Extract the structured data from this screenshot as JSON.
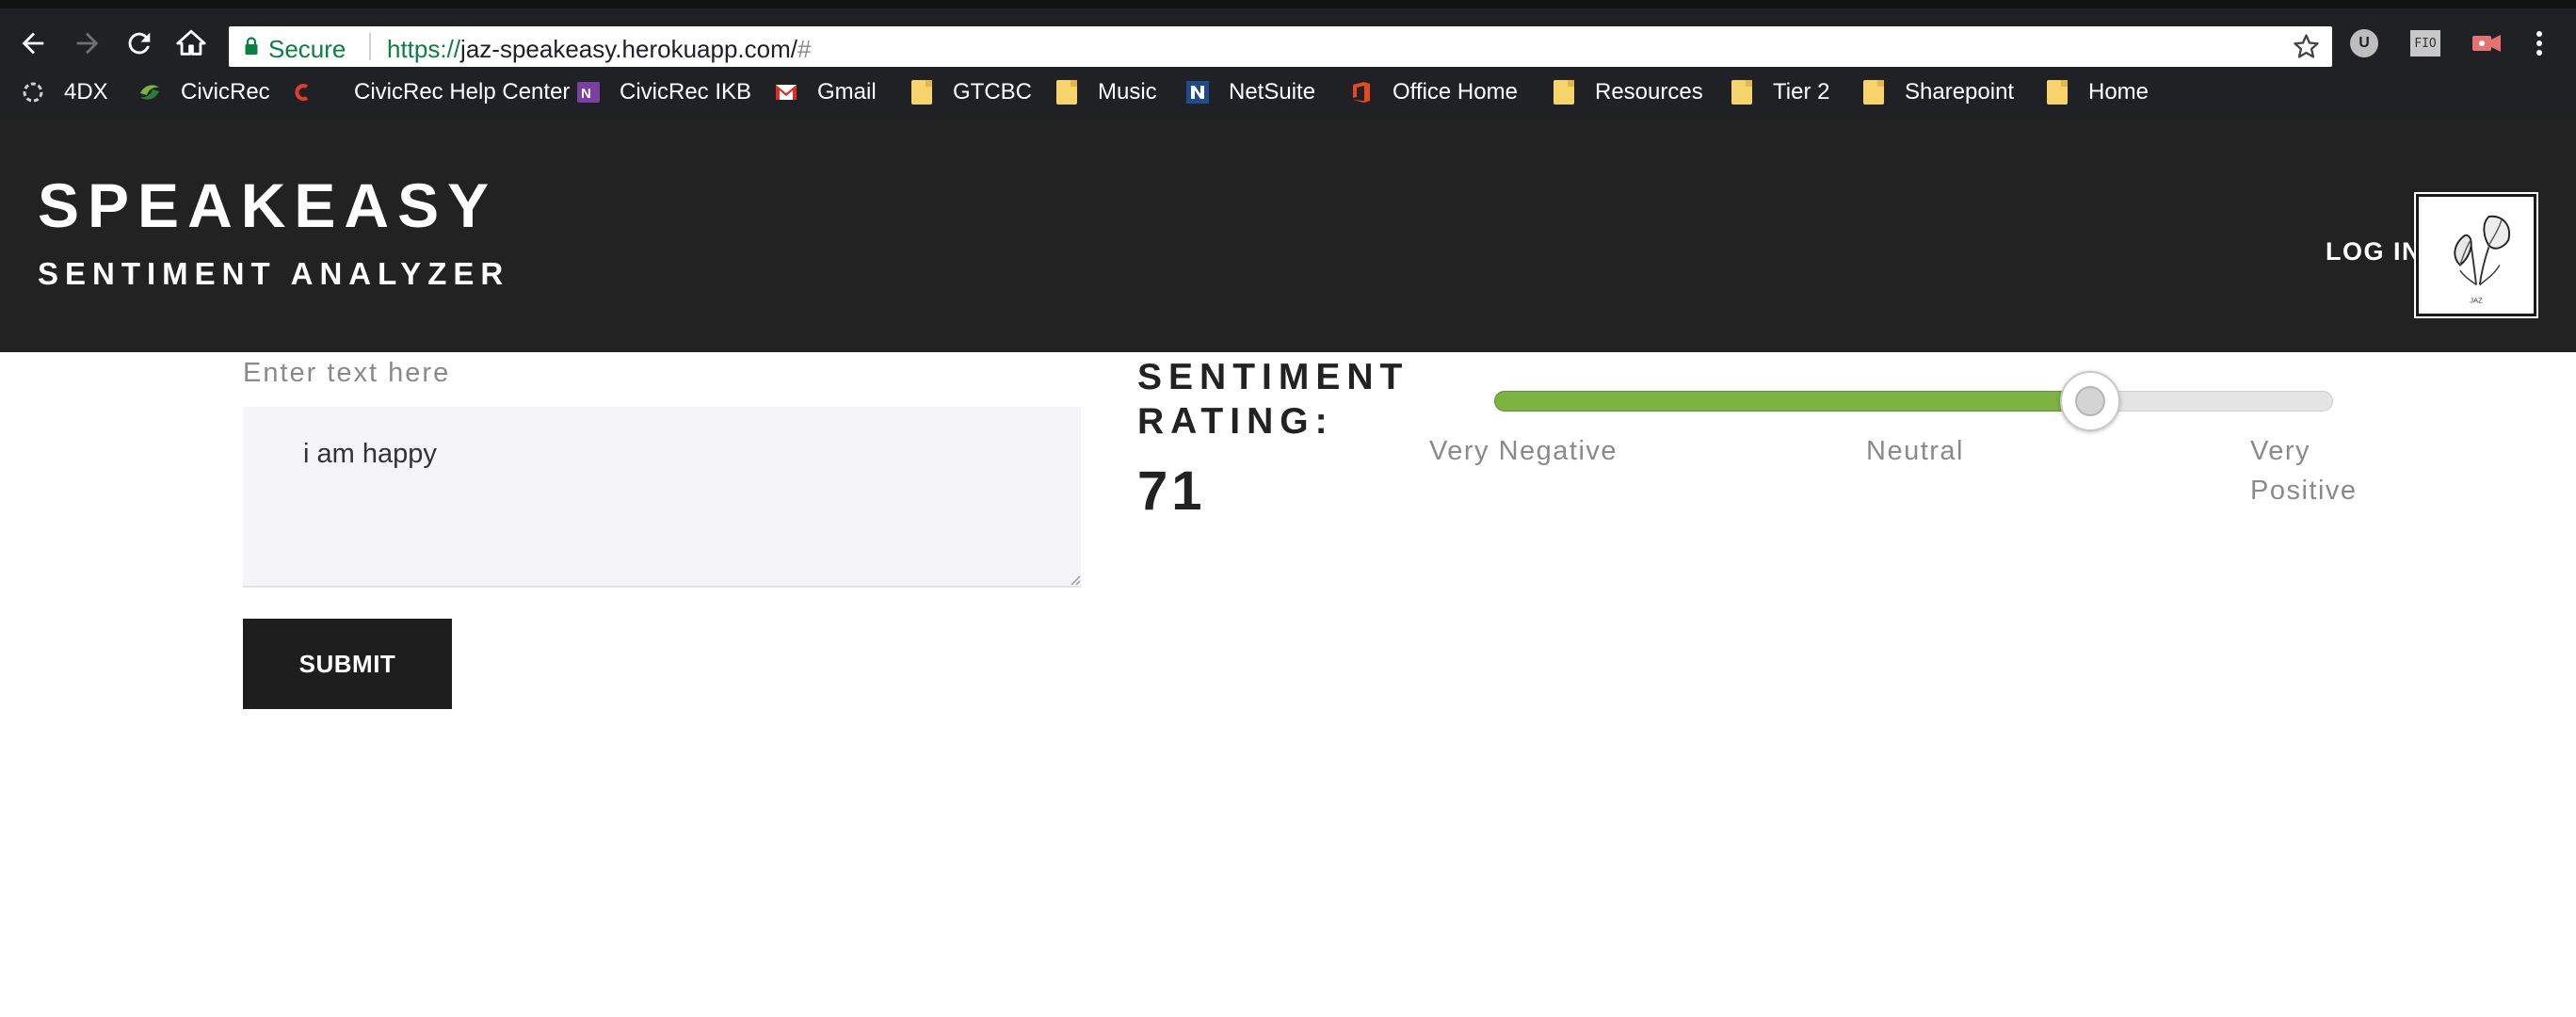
{
  "browser": {
    "secure_label": "Secure",
    "url_scheme": "https://",
    "url_host": "jaz-speakeasy.herokuapp.com/",
    "url_hash": "#",
    "extensions": {
      "u_label": "U",
      "fio_label": "FIO"
    },
    "bookmarks": [
      {
        "label": "4DX",
        "icon": "4dx-icon"
      },
      {
        "label": "CivicRec",
        "icon": "civicrec-icon"
      },
      {
        "label": "CivicRec Help Center",
        "icon": "civicrec-help-icon"
      },
      {
        "label": "CivicRec IKB",
        "icon": "onenote-icon"
      },
      {
        "label": "Gmail",
        "icon": "gmail-icon"
      },
      {
        "label": "GTCBC",
        "icon": "folder-icon"
      },
      {
        "label": "Music",
        "icon": "folder-icon"
      },
      {
        "label": "NetSuite",
        "icon": "netsuite-icon"
      },
      {
        "label": "Office Home",
        "icon": "office-icon"
      },
      {
        "label": "Resources",
        "icon": "folder-icon"
      },
      {
        "label": "Tier 2",
        "icon": "folder-icon"
      },
      {
        "label": "Sharepoint",
        "icon": "folder-icon"
      },
      {
        "label": "Home",
        "icon": "folder-icon"
      }
    ]
  },
  "header": {
    "title": "SPEAKEASY",
    "subtitle": "SENTIMENT ANALYZER",
    "login_label": "LOG IN",
    "avatar_caption": "JAZ"
  },
  "form": {
    "input_label": "Enter text here",
    "text_value": "i am happy",
    "submit_label": "SUBMIT"
  },
  "sentiment": {
    "heading_line1": "SENTIMENT",
    "heading_line2": "RATING:",
    "rating": 71,
    "scale_min": 0,
    "scale_max": 100,
    "scale_labels": {
      "very_negative": "Very Negative",
      "neutral": "Neutral",
      "very_positive_line1": "Very",
      "very_positive_line2": "Positive"
    },
    "fill_color": "#7cb342"
  }
}
